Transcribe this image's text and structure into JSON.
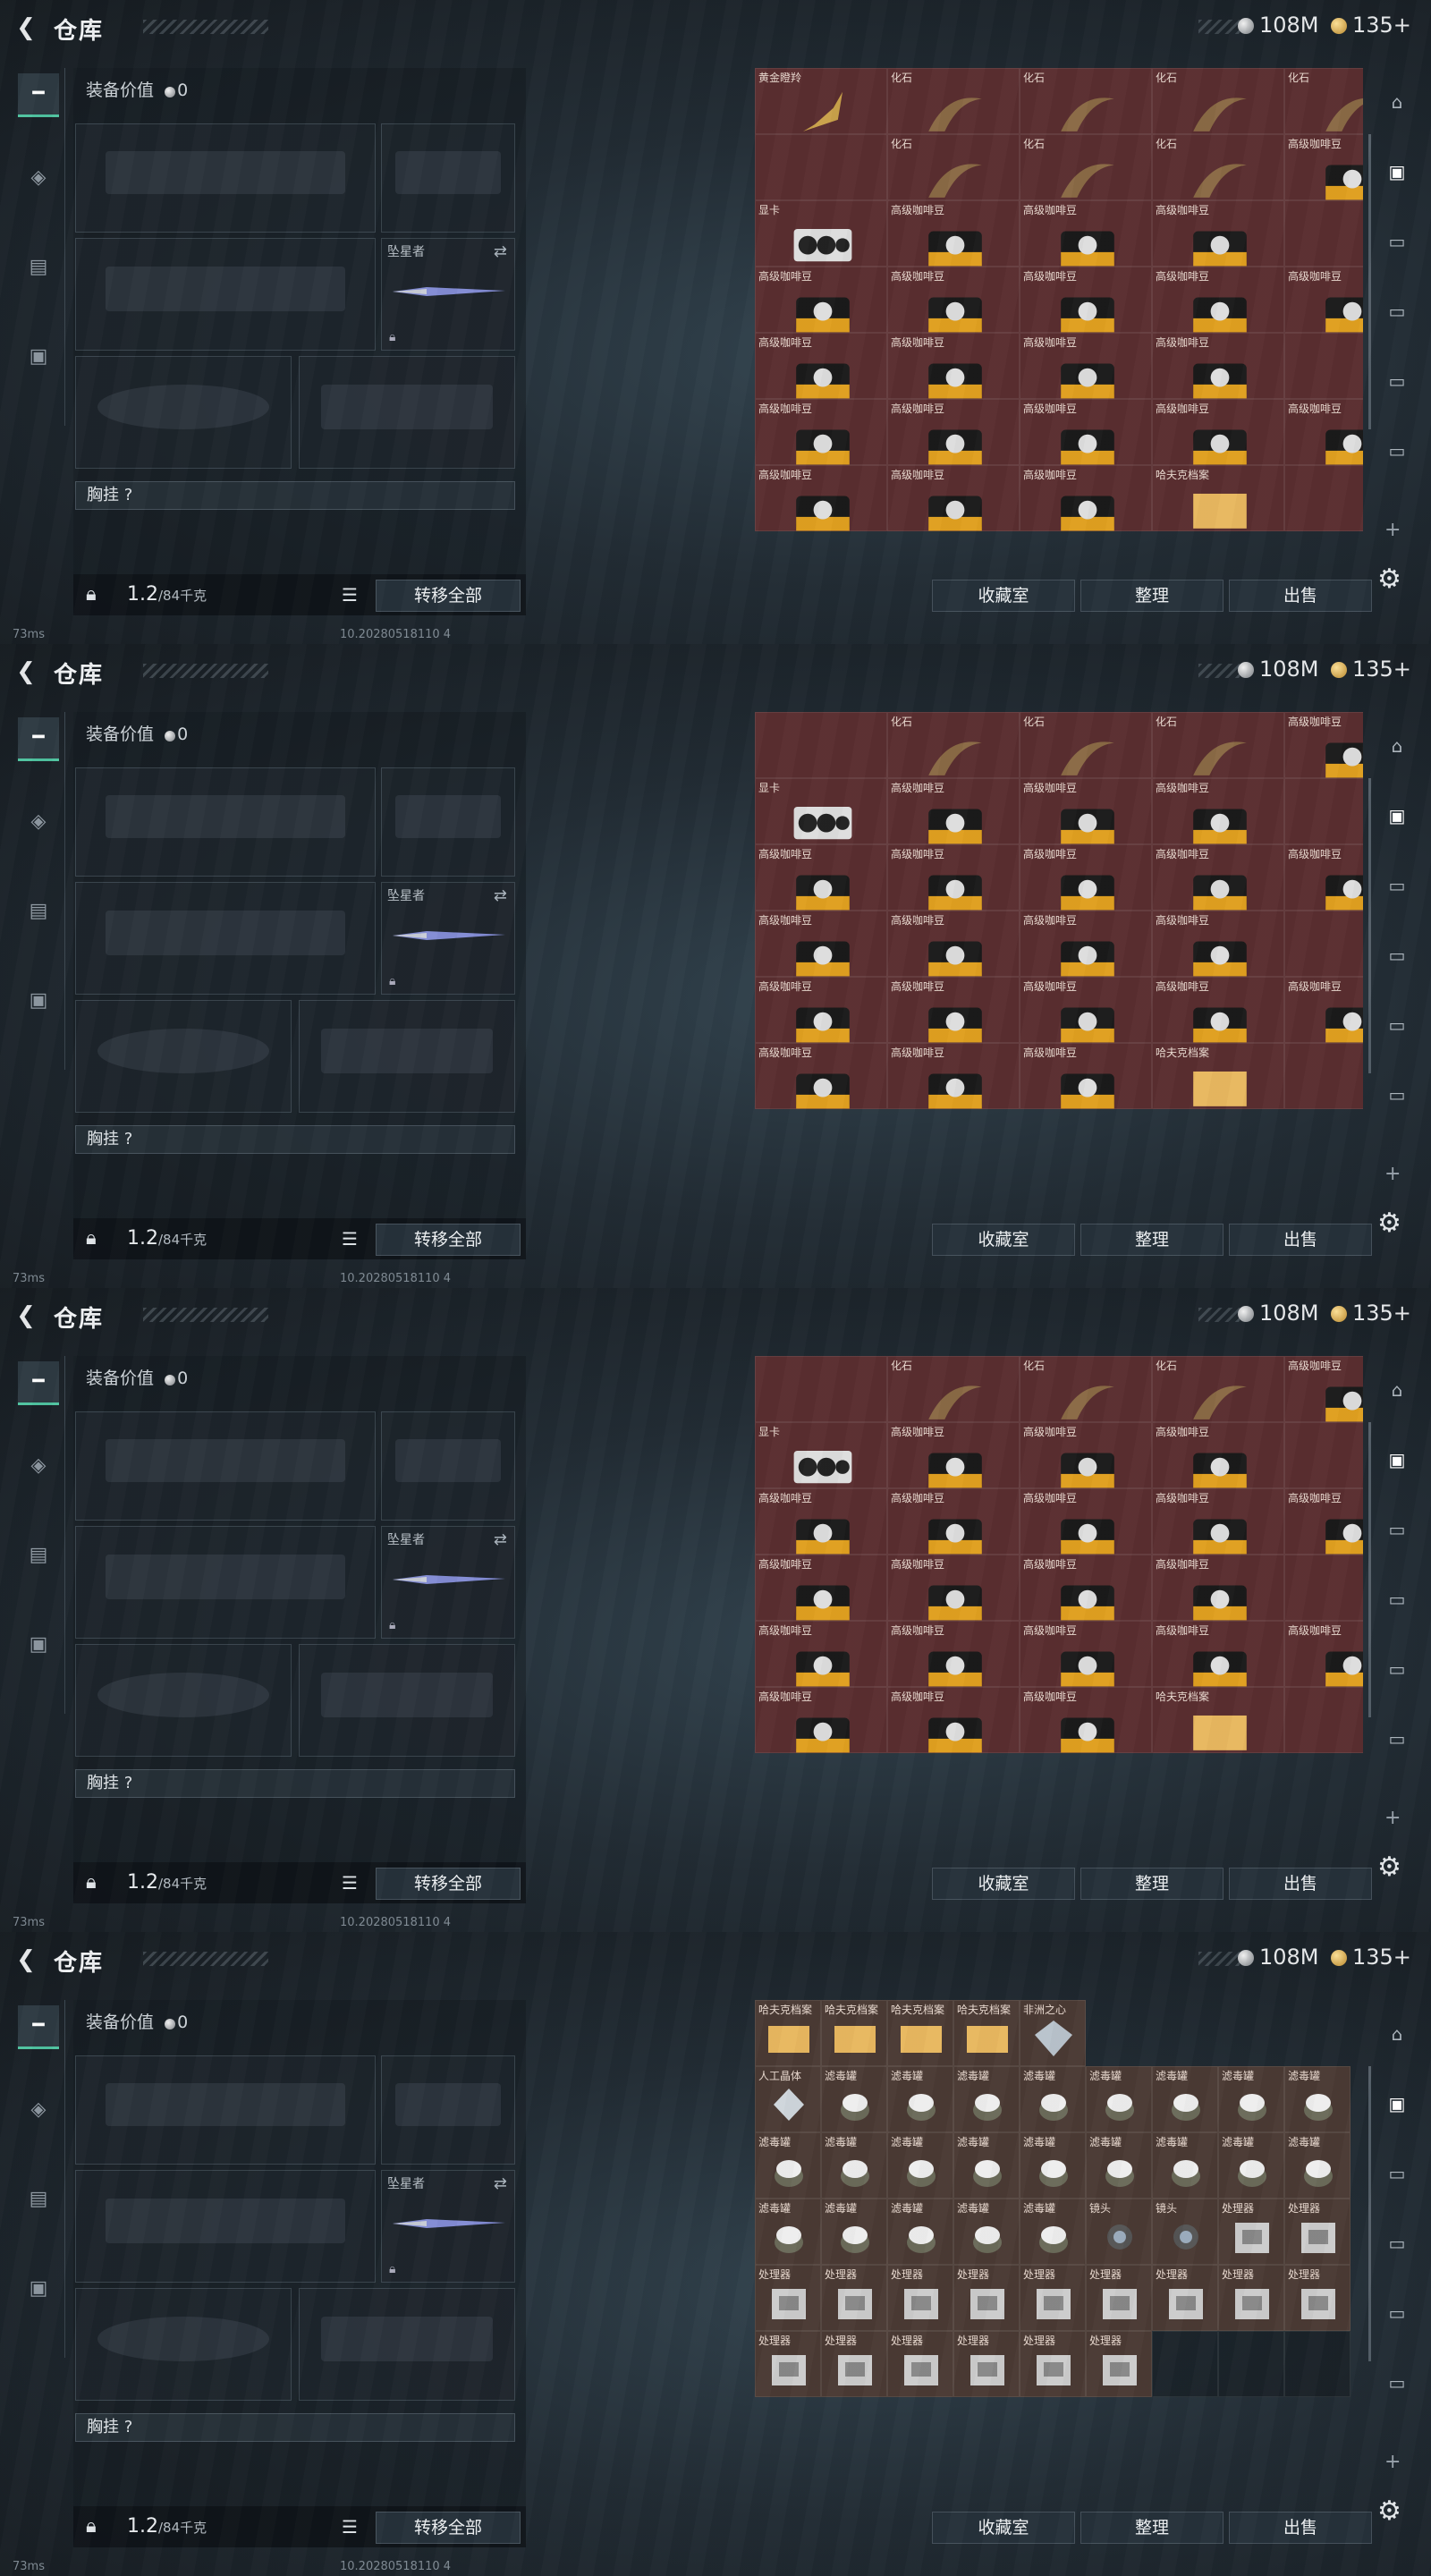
{
  "header": {
    "title": "仓库",
    "back_icon": "back-arrow-icon",
    "silver": "108M",
    "gold": "135+"
  },
  "left_tabs": [
    "gun-icon",
    "armor-icon",
    "backpack-icon",
    "briefcase-icon"
  ],
  "equipment": {
    "value_label": "装备价值",
    "value": "0",
    "melee_label": "坠星者",
    "chest_rig_label": "胸挂",
    "chest_rig_q": "?",
    "weight_value": "1.2",
    "weight_unit": "/84千克",
    "transfer_all": "转移全部"
  },
  "actions": {
    "collection": "收藏室",
    "sort": "整理",
    "sell": "出售"
  },
  "footer": {
    "ping": "73ms",
    "build": "10.20280518110 4"
  },
  "right_tabs": [
    "helmet-icon",
    "camera-icon",
    "tv-icon",
    "tv-icon",
    "tv-icon",
    "tv-icon",
    "plus-icon"
  ],
  "frames": [
    {
      "rows": [
        [
          "黄金瞪羚",
          "化石",
          "化石",
          "化石",
          "化石",
          "(container)"
        ],
        [
          "",
          "化石",
          "化石",
          "化石",
          "高级咖啡豆"
        ],
        [
          "显卡",
          "高级咖啡豆",
          "高级咖啡豆",
          "高级咖啡豆",
          ""
        ],
        [
          "高级咖啡豆",
          "高级咖啡豆",
          "高级咖啡豆",
          "高级咖啡豆",
          "高级咖啡豆"
        ],
        [
          "高级咖啡豆",
          "高级咖啡豆",
          "高级咖啡豆",
          "高级咖啡豆",
          ""
        ],
        [
          "高级咖啡豆",
          "高级咖啡豆",
          "高级咖啡豆",
          "高级咖啡豆",
          "高级咖啡豆"
        ],
        [
          "高级咖啡豆",
          "高级咖啡豆",
          "高级咖啡豆",
          "哈夫克档案",
          ""
        ]
      ]
    },
    {
      "rows": [
        [
          "",
          "化石",
          "化石",
          "化石",
          "高级咖啡豆"
        ],
        [
          "显卡",
          "高级咖啡豆",
          "高级咖啡豆",
          "高级咖啡豆",
          ""
        ],
        [
          "高级咖啡豆",
          "高级咖啡豆",
          "高级咖啡豆",
          "高级咖啡豆",
          "高级咖啡豆"
        ],
        [
          "高级咖啡豆",
          "高级咖啡豆",
          "高级咖啡豆",
          "高级咖啡豆",
          ""
        ],
        [
          "高级咖啡豆",
          "高级咖啡豆",
          "高级咖啡豆",
          "高级咖啡豆",
          "高级咖啡豆"
        ],
        [
          "高级咖啡豆",
          "高级咖啡豆",
          "高级咖啡豆",
          "哈夫克档案",
          ""
        ]
      ]
    },
    {
      "rows": [
        [
          "",
          "化石",
          "化石",
          "化石",
          "高级咖啡豆"
        ],
        [
          "显卡",
          "高级咖啡豆",
          "高级咖啡豆",
          "高级咖啡豆",
          ""
        ],
        [
          "高级咖啡豆",
          "高级咖啡豆",
          "高级咖啡豆",
          "高级咖啡豆",
          "高级咖啡豆"
        ],
        [
          "高级咖啡豆",
          "高级咖啡豆",
          "高级咖啡豆",
          "高级咖啡豆",
          ""
        ],
        [
          "高级咖啡豆",
          "高级咖啡豆",
          "高级咖啡豆",
          "高级咖啡豆",
          "高级咖啡豆"
        ],
        [
          "高级咖啡豆",
          "高级咖啡豆",
          "高级咖啡豆",
          "哈夫克档案",
          ""
        ]
      ]
    },
    {
      "rows": [
        [
          "哈夫克档案",
          "哈夫克档案",
          "哈夫克档案",
          "哈夫克档案",
          "非洲之心"
        ],
        [
          "人工晶体",
          "滤毒罐",
          "滤毒罐",
          "滤毒罐",
          "滤毒罐",
          "滤毒罐",
          "滤毒罐",
          "滤毒罐",
          "滤毒罐"
        ],
        [
          "滤毒罐",
          "滤毒罐",
          "滤毒罐",
          "滤毒罐",
          "滤毒罐",
          "滤毒罐",
          "滤毒罐",
          "滤毒罐",
          "滤毒罐"
        ],
        [
          "滤毒罐",
          "滤毒罐",
          "滤毒罐",
          "滤毒罐",
          "滤毒罐",
          "镜头",
          "镜头",
          "处理器",
          "处理器"
        ],
        [
          "处理器",
          "处理器",
          "处理器",
          "处理器",
          "处理器",
          "处理器",
          "处理器",
          "处理器",
          "处理器"
        ],
        [
          "处理器",
          "处理器",
          "处理器",
          "处理器",
          "处理器",
          "处理器",
          "",
          "",
          ""
        ]
      ]
    }
  ]
}
